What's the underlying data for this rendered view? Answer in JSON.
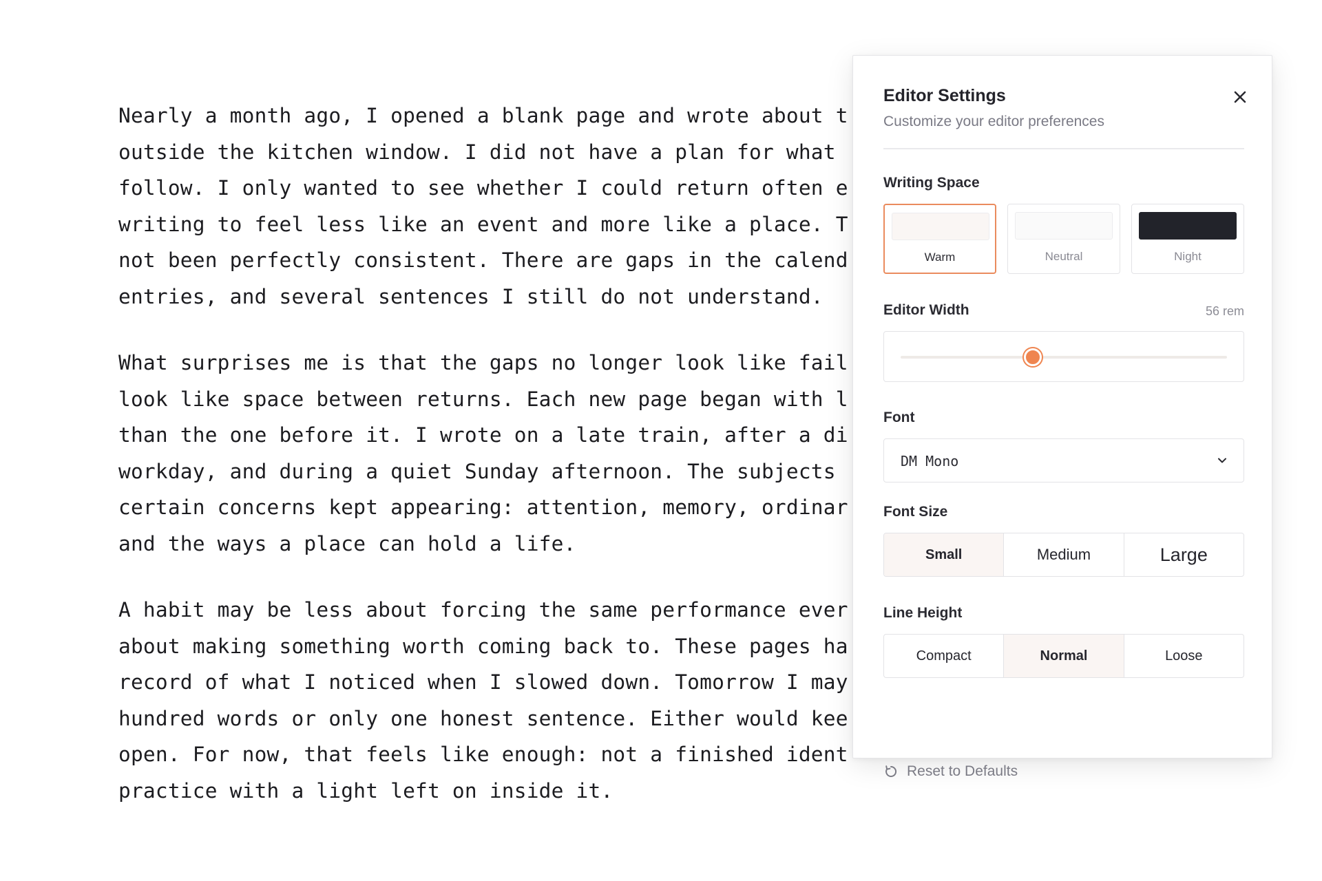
{
  "editor": {
    "paragraphs": [
      [
        "Nearly a month ago, I opened a blank page and wrote about t",
        "outside the kitchen window. I did not have a plan for what",
        "follow. I only wanted to see whether I could return often e",
        "writing to feel less like an event and more like a place. T",
        "not been perfectly consistent. There are gaps in the calend",
        "entries, and several sentences I still do not understand."
      ],
      [
        "What surprises me is that the gaps no longer look like fail",
        "look like space between returns. Each new page began with l",
        "than the one before it. I wrote on a late train, after a di",
        "workday, and during a quiet Sunday afternoon. The subjects",
        "certain concerns kept appearing: attention, memory, ordinar",
        "and the ways a place can hold a life."
      ],
      [
        "A habit may be less about forcing the same performance ever",
        "about making something worth coming back to. These pages ha",
        "record of what I noticed when I slowed down. Tomorrow I may",
        "hundred words or only one honest sentence. Either would kee",
        "open. For now, that feels like enough: not a finished ident",
        "practice with a light left on inside it."
      ]
    ]
  },
  "settings": {
    "title": "Editor Settings",
    "subtitle": "Customize your editor preferences",
    "close_icon": "close-icon",
    "writing_space": {
      "label": "Writing Space",
      "options": [
        {
          "label": "Warm",
          "swatch": "#faf6f4",
          "selected": true
        },
        {
          "label": "Neutral",
          "swatch": "#fafafa",
          "selected": false
        },
        {
          "label": "Night",
          "swatch": "#22232a",
          "selected": false
        }
      ],
      "accent": "#ea8b5d"
    },
    "editor_width": {
      "label": "Editor Width",
      "value_text": "56 rem",
      "fraction": 0.405,
      "thumb_color": "#ef8550"
    },
    "font": {
      "label": "Font",
      "value": "DM Mono",
      "icon": "chevron-down-icon"
    },
    "font_size": {
      "label": "Font Size",
      "options": [
        "Small",
        "Medium",
        "Large"
      ],
      "selected": "Small"
    },
    "line_height": {
      "label": "Line Height",
      "options": [
        "Compact",
        "Normal",
        "Loose"
      ],
      "selected": "Normal"
    },
    "reset": {
      "label": "Reset to Defaults",
      "icon": "reset-icon"
    }
  }
}
